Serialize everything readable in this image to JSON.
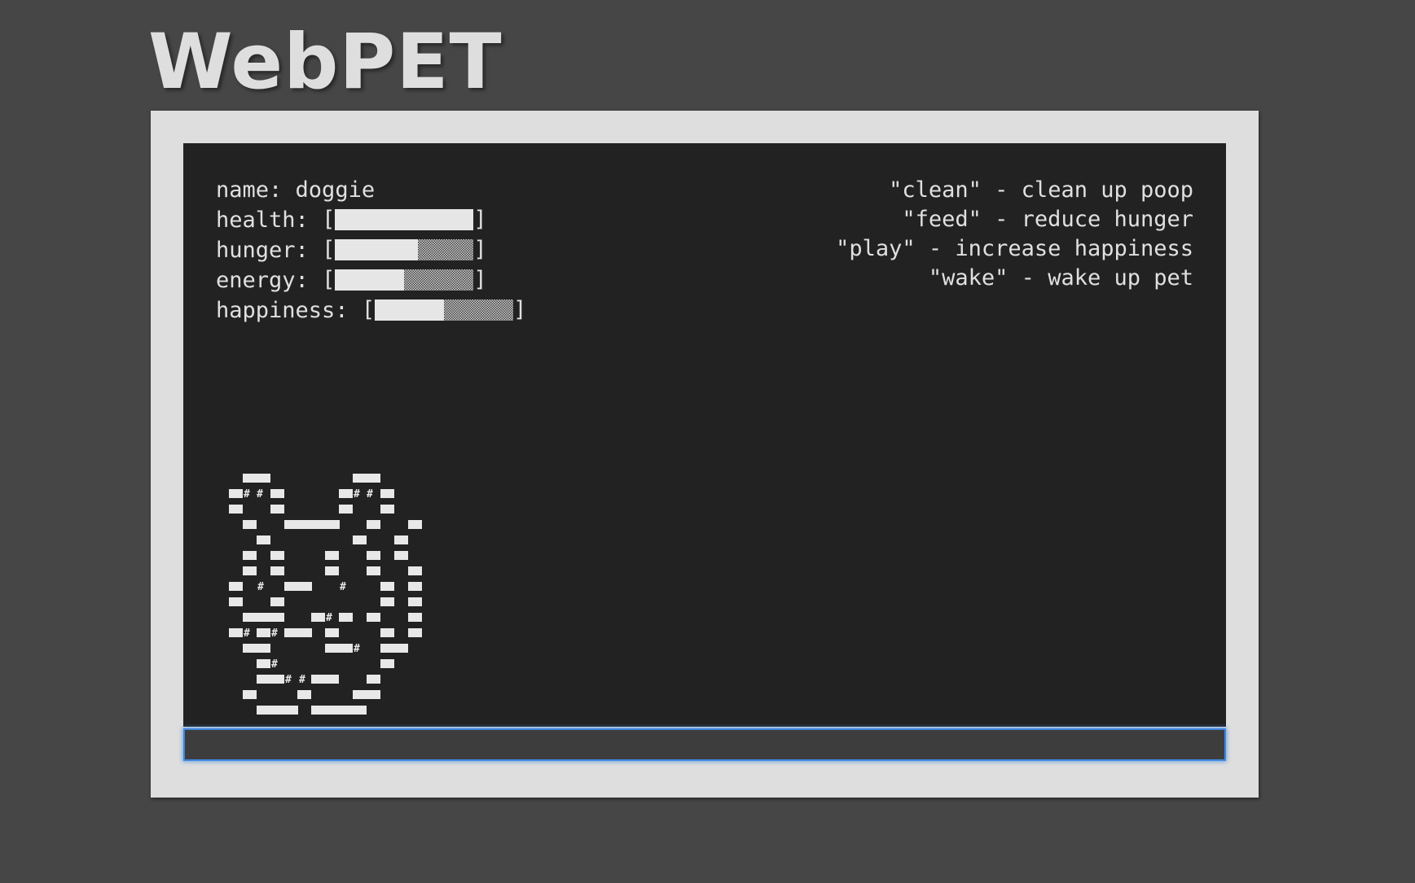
{
  "app": {
    "title": "WebPET"
  },
  "pet": {
    "name_label": "name:",
    "name": "doggie",
    "stats": [
      {
        "key": "health",
        "label": "health:",
        "level": 1.0
      },
      {
        "key": "hunger",
        "label": "hunger:",
        "level": 0.6
      },
      {
        "key": "energy",
        "label": "energy:",
        "level": 0.5
      },
      {
        "key": "happiness",
        "label": "happiness:",
        "level": 0.5
      }
    ],
    "bracket_open": "[",
    "bracket_close": "]"
  },
  "commands": [
    {
      "text": "\"clean\" - clean up poop"
    },
    {
      "text": "\"feed\" - reduce hunger"
    },
    {
      "text": "\"play\" - increase happiness"
    },
    {
      "text": "\"wake\" - wake up pet"
    }
  ],
  "input": {
    "value": "",
    "placeholder": ""
  },
  "colors": {
    "page_background": "#464646",
    "frame": "#dedede",
    "screen": "#222222",
    "text": "#e0e0e0",
    "input_focus": "#3f86e0"
  },
  "pet_art_icon": "ascii-dog"
}
